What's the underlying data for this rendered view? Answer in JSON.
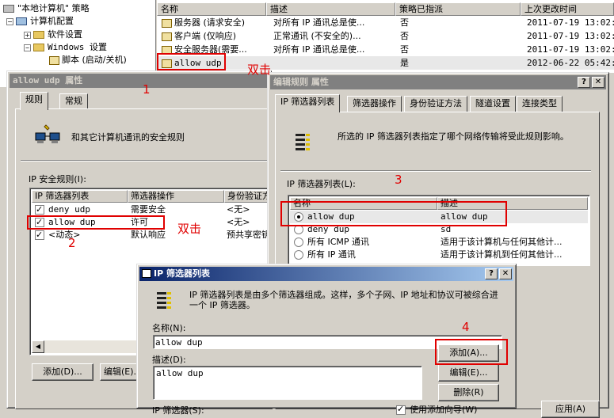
{
  "tree": {
    "root": "\"本地计算机\" 策略",
    "computer_config": "计算机配置",
    "software_settings": "软件设置",
    "windows_settings": "Windows 设置",
    "scripts": "脚本 (启动/关机)"
  },
  "list": {
    "headers": [
      "名称",
      "描述",
      "策略已指派",
      "上次更改时间"
    ],
    "rows": [
      {
        "name": "服务器 (请求安全)",
        "desc": "对所有 IP 通讯总是使...",
        "assigned": "否",
        "changed": "2011-07-19 13:02:2"
      },
      {
        "name": "客户端 (仅响应)",
        "desc": "正常通讯 (不安全的)...",
        "assigned": "否",
        "changed": "2011-07-19 13:02:2"
      },
      {
        "name": "安全服务器(需要...",
        "desc": "对所有 IP 通讯总是使...",
        "assigned": "否",
        "changed": "2011-07-19 13:02:2"
      },
      {
        "name": "allow udp",
        "desc": "",
        "assigned": "是",
        "changed": "2012-06-22 05:42:2"
      }
    ]
  },
  "props": {
    "title": "allow udp 属性",
    "tabs": [
      "规则",
      "常规"
    ],
    "intro": "和其它计算机通讯的安全规则",
    "rules_label": "IP 安全规则(I):",
    "headers": [
      "IP 筛选器列表",
      "筛选器操作",
      "身份验证方"
    ],
    "rows": [
      {
        "checked": true,
        "list": "deny udp",
        "action": "需要安全",
        "auth": "<无>"
      },
      {
        "checked": true,
        "list": "allow dup",
        "action": "许可",
        "auth": "<无>"
      },
      {
        "checked": true,
        "list": "<动态>",
        "action": "默认响应",
        "auth": "预共享密钥"
      }
    ],
    "add": "添加(D)...",
    "edit": "编辑(E)..."
  },
  "edit_rule": {
    "title": "编辑规则 属性",
    "tabs": [
      "IP 筛选器列表",
      "筛选器操作",
      "身份验证方法",
      "隧道设置",
      "连接类型"
    ],
    "intro": "所选的 IP 筛选器列表指定了哪个网络传输将受此规则影响。",
    "list_label": "IP 筛选器列表(L):",
    "headers": [
      "名称",
      "描述"
    ],
    "rows": [
      {
        "selected": true,
        "name": "allow dup",
        "desc": "allow dup"
      },
      {
        "selected": false,
        "name": "deny dup",
        "desc": "sd"
      },
      {
        "selected": false,
        "name": "所有 ICMP 通讯",
        "desc": "适用于该计算机与任何其他计..."
      },
      {
        "selected": false,
        "name": "所有 IP 通讯",
        "desc": "适用于该计算机到任何其他计..."
      }
    ]
  },
  "filter_list": {
    "title": "IP 筛选器列表",
    "intro": "IP 筛选器列表是由多个筛选器组成。这样，多个子网、IP 地址和协议可被综合进一个 IP 筛选器。",
    "name_label": "名称(N):",
    "name_value": "allow dup",
    "desc_label": "描述(D):",
    "desc_value": "allow dup",
    "add": "添加(A)...",
    "edit": "编辑(E)...",
    "remove": "删除(R)",
    "filters_label": "IP 筛选器(S):",
    "use_wizard": "使用添加向导(W)"
  },
  "bottom_buttons": {
    "apply": "应用(A)"
  },
  "annotations": {
    "n1": "1",
    "n2": "2",
    "n3": "3",
    "n4": "4",
    "dbl1": "双击",
    "dbl2": "双击"
  },
  "colors": {
    "annotation": "#e00000",
    "active_title": "#0a246a",
    "selection": "#e8e8e8"
  }
}
